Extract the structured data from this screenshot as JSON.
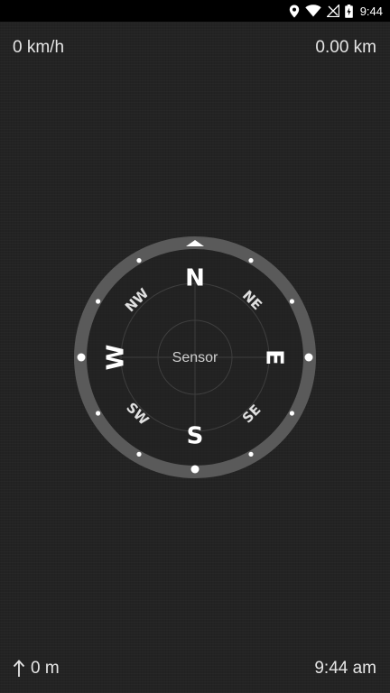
{
  "status_bar": {
    "time": "9:44",
    "icons": [
      "location-icon",
      "wifi-icon",
      "no-signal-icon",
      "battery-charging-icon"
    ]
  },
  "speed": "0 km/h",
  "distance": "0.00 km",
  "altitude": {
    "icon": "arrow-up-icon",
    "value": "0 m"
  },
  "clock": "9:44 am",
  "compass": {
    "center_label": "Sensor",
    "cardinals": {
      "north": "N",
      "east": "E",
      "south": "S",
      "west": "W"
    },
    "intercardinals": {
      "northeast": "NE",
      "southeast": "SE",
      "southwest": "SW",
      "northwest": "NW"
    }
  }
}
